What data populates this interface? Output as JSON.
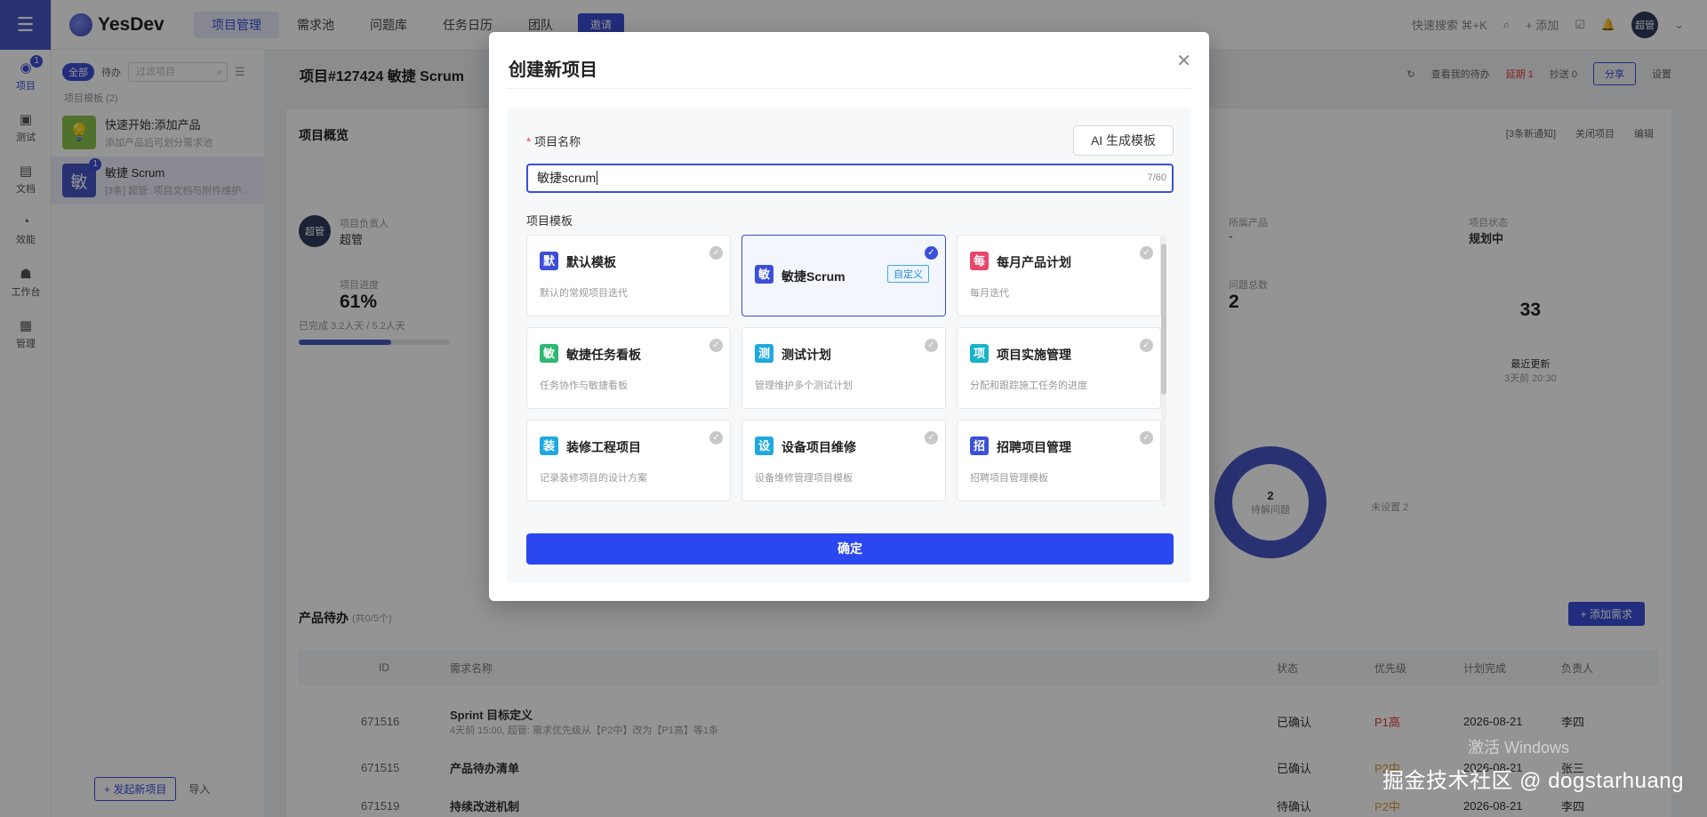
{
  "rail": {
    "items": [
      {
        "label": "项目",
        "badge": "1"
      },
      {
        "label": "测试"
      },
      {
        "label": "文档"
      },
      {
        "label": "效能"
      },
      {
        "label": "工作台"
      },
      {
        "label": "管理"
      }
    ]
  },
  "topbar": {
    "logo": "YesDev",
    "nav": [
      "项目管理",
      "需求池",
      "问题库",
      "任务日历",
      "团队"
    ],
    "invite": "邀请",
    "search_placeholder": "快速搜索 ⌘+K",
    "add_label": "+ 添加",
    "avatar": "超管"
  },
  "sidebar": {
    "filter_all": "全部",
    "filter_todo": "待办",
    "search_placeholder": "过滤项目",
    "section": "项目模板 (2)",
    "projects": [
      {
        "icon": "💡",
        "name": "快速开始:添加产品",
        "sub": "添加产品后可划分需求池"
      },
      {
        "icon": "敏",
        "name": "敏捷 Scrum",
        "sub": "[3条] 超管: 项目文档与附件维护...",
        "badge": "1"
      }
    ],
    "new_project": "+ 发起新项目",
    "import": "导入"
  },
  "main": {
    "breadcrumb": "项目#127424 敏捷 Scrum",
    "toolbar": {
      "todo": "查看我的待办",
      "overdue": "延期 1",
      "cc": "抄送 0",
      "share": "分享",
      "settings": "设置"
    },
    "overview": {
      "title": "项目概览",
      "notice": "[3条新通知]",
      "close": "关闭项目",
      "edit": "编辑",
      "owner_label": "项目负责人",
      "owner": "超管",
      "progress_label": "项目进度",
      "progress": "61%",
      "progress_sub": "已完成 3.2人天 / 5.2人天",
      "new_product_label": "所属产品",
      "new_product": "-",
      "status_label": "项目状态",
      "status": "规划中",
      "issues_label": "问题总数",
      "issues": "2",
      "issues_side": "2",
      "update_count": "33",
      "update_label": "最近更新",
      "update_time": "3天前 20:30",
      "donut_value": "2",
      "donut_label": "待解问题",
      "unassigned": "未设置 2"
    },
    "backlog": {
      "title": "产品待办",
      "count": "(共0/5个)",
      "add_btn": "+ 添加需求",
      "headers": [
        "ID",
        "需求名称",
        "状态",
        "优先级",
        "计划完成",
        "负责人"
      ],
      "rows": [
        {
          "id": "671516",
          "name": "Sprint 目标定义",
          "sub": "4天前 15:00, 超管: 需求优先级从【P2中】改为【P1高】等1条",
          "status": "已确认",
          "priority": "P1高",
          "date": "2026-08-21",
          "owner": "李四"
        },
        {
          "id": "671515",
          "name": "产品待办清单",
          "sub": "",
          "status": "已确认",
          "priority": "P2中",
          "date": "2026-08-21",
          "owner": "张三"
        },
        {
          "id": "671519",
          "name": "持续改进机制",
          "sub": "",
          "status": "待确认",
          "priority": "P2中",
          "date": "2026-08-21",
          "owner": "李四"
        }
      ]
    }
  },
  "modal": {
    "title": "创建新项目",
    "name_label": "项目名称",
    "ai_button": "AI 生成模板",
    "name_value": "敏捷scrum",
    "name_counter": "7/60",
    "template_label": "项目模板",
    "templates": [
      {
        "icon": "默",
        "color": "#3b4fd8",
        "name": "默认模板",
        "desc": "默认的常规项目迭代",
        "selected": false
      },
      {
        "icon": "敏",
        "color": "#3b4fd8",
        "name": "敏捷Scrum",
        "desc": "",
        "selected": true,
        "tag": "自定义"
      },
      {
        "icon": "每",
        "color": "#e8466b",
        "name": "每月产品计划",
        "desc": "每月迭代",
        "selected": false
      },
      {
        "icon": "敏",
        "color": "#2eb872",
        "name": "敏捷任务看板",
        "desc": "任务协作与敏捷看板",
        "selected": false
      },
      {
        "icon": "测",
        "color": "#1ea8e0",
        "name": "测试计划",
        "desc": "管理维护多个测试计划",
        "selected": false
      },
      {
        "icon": "项",
        "color": "#17b3c9",
        "name": "项目实施管理",
        "desc": "分配和跟踪施工任务的进度",
        "selected": false
      },
      {
        "icon": "装",
        "color": "#1ea8e0",
        "name": "装修工程项目",
        "desc": "记录装修项目的设计方案",
        "selected": false
      },
      {
        "icon": "设",
        "color": "#1ea8e0",
        "name": "设备项目维修",
        "desc": "设备维修管理项目模板",
        "selected": false
      },
      {
        "icon": "招",
        "color": "#3b4fd8",
        "name": "招聘项目管理",
        "desc": "招聘项目管理模板",
        "selected": false
      }
    ],
    "confirm": "确定"
  },
  "watermark": "掘金技术社区 @ dogstarhuang",
  "windows_watermark": "激活 Windows"
}
